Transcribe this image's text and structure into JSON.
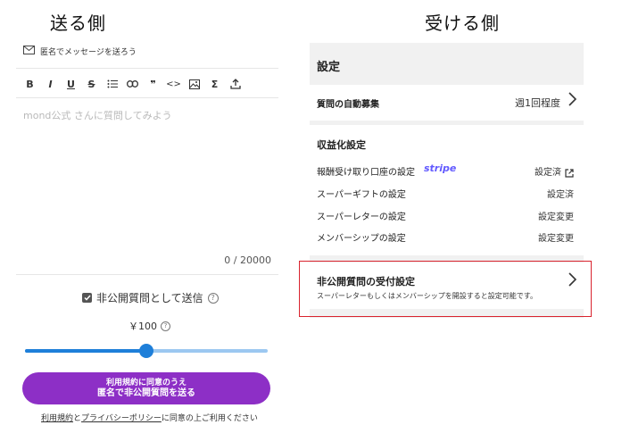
{
  "left": {
    "heading": "送る側",
    "anon_label": "匿名でメッセージを送ろう",
    "toolbar": {
      "bold": "B",
      "italic": "I",
      "underline": "U",
      "strike": "S",
      "quote": "❞",
      "code": "<>",
      "sigma": "Σ"
    },
    "placeholder": "mond公式 さんに質問してみよう",
    "counter": "0 / 20000",
    "private_label": "非公開質問として送信",
    "price": "￥100",
    "slider_level": 0.5,
    "submit_line1": "利用規約に同意のうえ",
    "submit_line2": "匿名で非公開質問を送る",
    "terms_link1": "利用規約",
    "terms_and": "と",
    "terms_link2": "プライバシーポリシー",
    "terms_tail": "に同意の上ご利用ください"
  },
  "right": {
    "heading": "受ける側",
    "settings_title": "設定",
    "auto_label": "質問の自動募集",
    "auto_value": "週1回程度",
    "monetize_title": "収益化設定",
    "rows": [
      {
        "label": "報酬受け取り口座の設定",
        "brand": "stripe",
        "value": "設定済"
      },
      {
        "label": "スーパーギフトの設定",
        "value": "設定済"
      },
      {
        "label": "スーパーレターの設定",
        "value": "設定変更"
      },
      {
        "label": "メンバーシップの設定",
        "value": "設定変更"
      }
    ],
    "private_title": "非公開質問の受付設定",
    "private_desc": "スーパーレターもしくはメンバーシップを開設すると設定可能です。"
  },
  "colors": {
    "accent_purple": "#8d2fc6",
    "slider_blue": "#1e7fd9",
    "stripe": "#635bff",
    "highlight_red": "#d9232e"
  }
}
